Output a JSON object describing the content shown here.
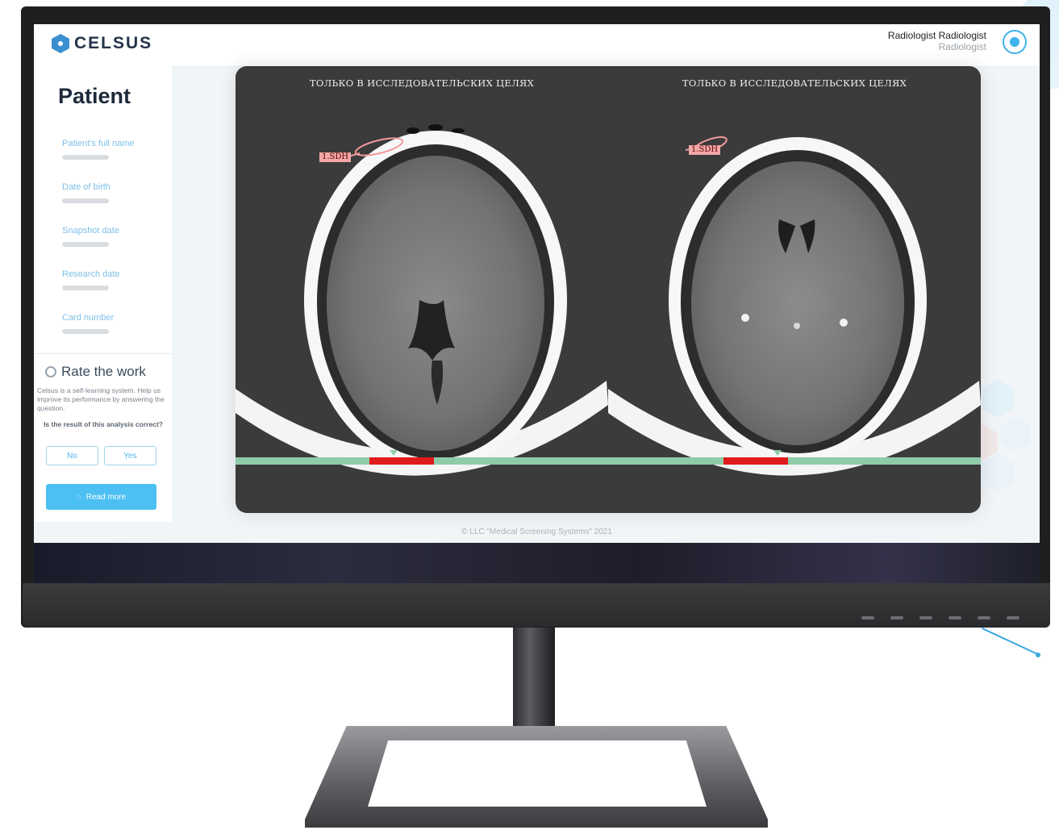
{
  "app": {
    "logo_text": "CELSUS",
    "user_name": "Radiologist Radiologist",
    "user_role": "Radiologist"
  },
  "sidebar": {
    "title": "Patient",
    "fields": [
      {
        "label": "Patient's full name"
      },
      {
        "label": "Date of birth"
      },
      {
        "label": "Snapshot date"
      },
      {
        "label": "Research date"
      },
      {
        "label": "Card number"
      }
    ],
    "rate": {
      "title": "Rate the work",
      "description": "Celsus is a self-learning system. Help us improve its performance by answering the question.",
      "question": "Is the result of this analysis correct?",
      "no_label": "No",
      "yes_label": "Yes"
    },
    "read_more_label": "Read more"
  },
  "viewer": {
    "panes": [
      {
        "caption": "ТОЛЬКО В ИССЛЕДОВАТЕЛЬСКИХ ЦЕЛЯХ",
        "finding_label": "1.SDH"
      },
      {
        "caption": "ТОЛЬКО В ИССЛЕДОВАТЕЛЬСКИХ ЦЕЛЯХ",
        "finding_label": "1.SDH"
      }
    ],
    "timeline_color": "#8fcba8",
    "finding_color": "#e01b1b"
  },
  "footer": {
    "text": "© LLC \"Medical Screening Systems\" 2021"
  },
  "colors": {
    "accent": "#4cbff3",
    "viewer_bg": "#3b3b3b"
  }
}
